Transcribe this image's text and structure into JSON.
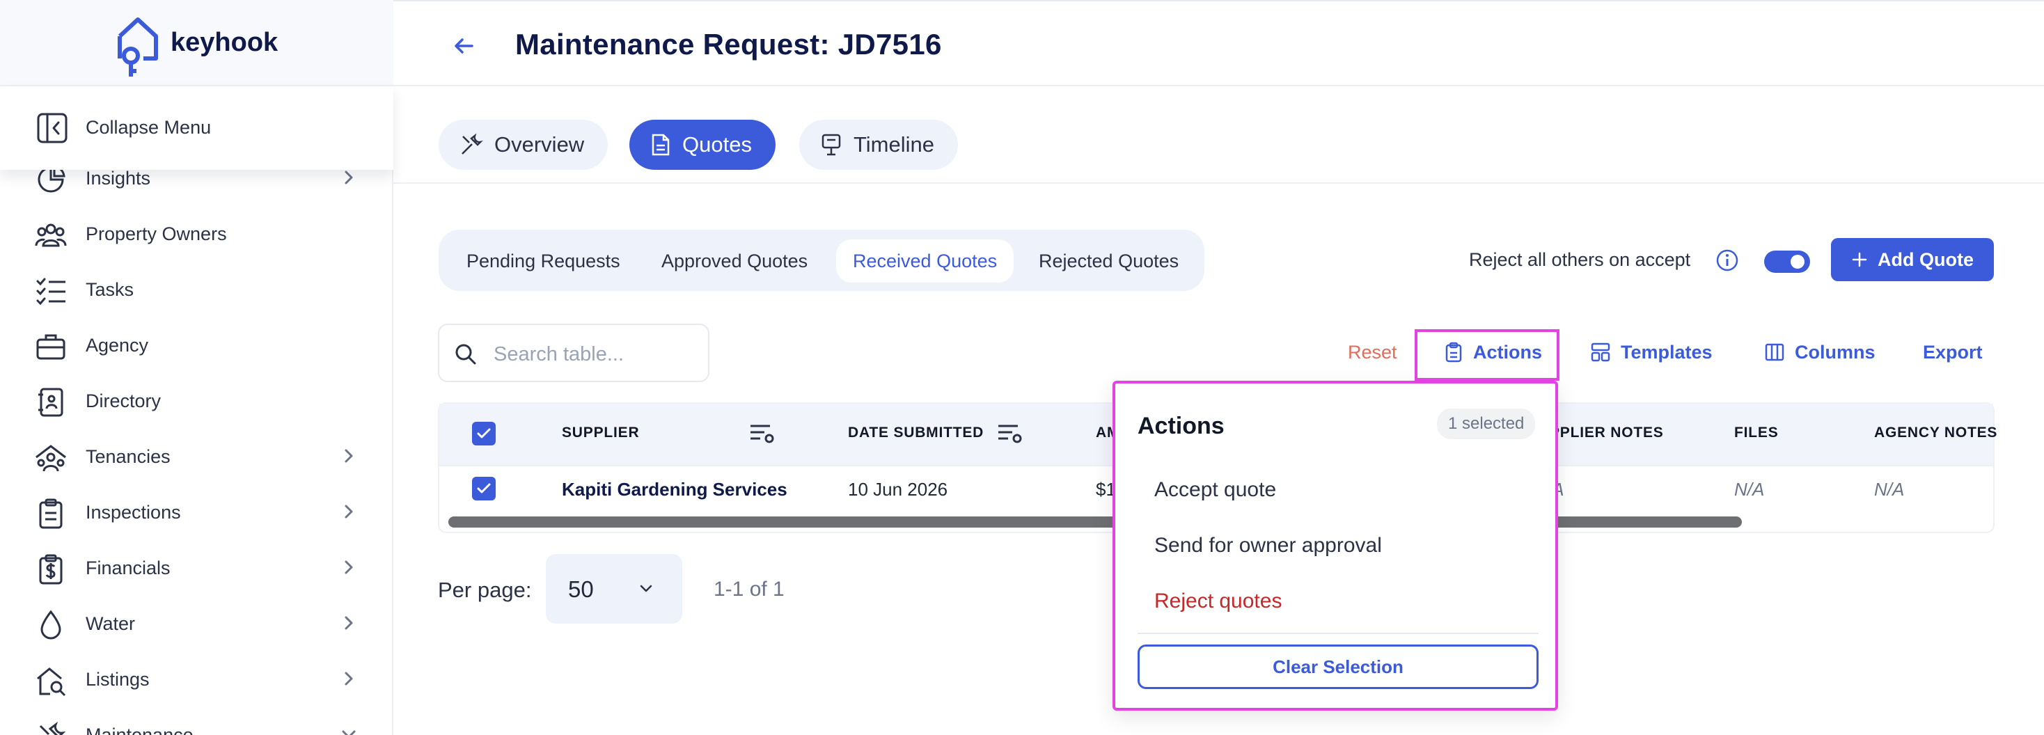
{
  "app": {
    "brand": "keyhook"
  },
  "sidebar": {
    "collapse_label": "Collapse Menu",
    "items": [
      {
        "label": "Insights",
        "icon": "insights-icon",
        "has_chevron": true
      },
      {
        "label": "Property Owners",
        "icon": "people-icon",
        "has_chevron": false
      },
      {
        "label": "Tasks",
        "icon": "task-list-icon",
        "has_chevron": false
      },
      {
        "label": "Agency",
        "icon": "briefcase-icon",
        "has_chevron": false
      },
      {
        "label": "Directory",
        "icon": "address-book-icon",
        "has_chevron": false
      },
      {
        "label": "Tenancies",
        "icon": "tenants-icon",
        "has_chevron": true
      },
      {
        "label": "Inspections",
        "icon": "clipboard-icon",
        "has_chevron": true
      },
      {
        "label": "Financials",
        "icon": "dollar-clipboard-icon",
        "has_chevron": true
      },
      {
        "label": "Water",
        "icon": "water-drop-icon",
        "has_chevron": true
      },
      {
        "label": "Listings",
        "icon": "house-search-icon",
        "has_chevron": true
      },
      {
        "label": "Maintenance",
        "icon": "tools-icon",
        "has_chevron": true
      }
    ]
  },
  "header": {
    "title": "Maintenance Request: JD7516"
  },
  "tabs": [
    {
      "label": "Overview",
      "active": false
    },
    {
      "label": "Quotes",
      "active": true
    },
    {
      "label": "Timeline",
      "active": false
    }
  ],
  "subtabs": [
    {
      "label": "Pending Requests",
      "active": false
    },
    {
      "label": "Approved Quotes",
      "active": false
    },
    {
      "label": "Received Quotes",
      "active": true
    },
    {
      "label": "Rejected Quotes",
      "active": false
    }
  ],
  "reject_toggle": {
    "label": "Reject all others on accept",
    "on": true
  },
  "add_quote_label": "Add Quote",
  "search": {
    "placeholder": "Search table..."
  },
  "toolbar": {
    "reset": "Reset",
    "actions": "Actions",
    "templates": "Templates",
    "columns": "Columns",
    "export": "Export"
  },
  "table": {
    "columns": [
      "SUPPLIER",
      "DATE SUBMITTED",
      "AM",
      "UPPLIER NOTES",
      "FILES",
      "AGENCY NOTES"
    ],
    "rows": [
      {
        "supplier": "Kapiti Gardening Services",
        "date": "10 Jun 2026",
        "amount": "$1",
        "supplier_notes": "/A",
        "files": "N/A",
        "agency_notes": "N/A"
      }
    ]
  },
  "pagination": {
    "label": "Per page:",
    "value": "50",
    "range": "1-1 of 1"
  },
  "actions_popover": {
    "title": "Actions",
    "badge": "1 selected",
    "items": [
      "Accept quote",
      "Send for owner approval",
      "Reject quotes"
    ],
    "clear_label": "Clear Selection"
  },
  "colors": {
    "accent": "#3b5bdb",
    "danger": "#c62828",
    "highlight": "#e443e4",
    "reset": "#e36b5a"
  }
}
